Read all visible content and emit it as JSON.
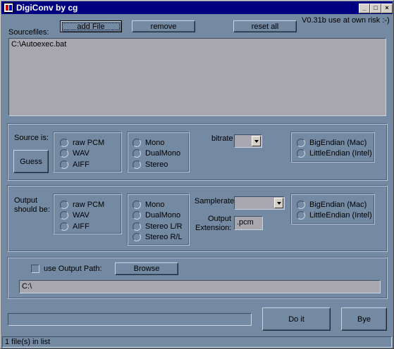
{
  "window": {
    "title": "DigiConv by cg",
    "minimize_glyph": "_",
    "maximize_glyph": "□",
    "close_glyph": "×"
  },
  "toolbar": {
    "add_file_label": "add File",
    "remove_label": "remove",
    "reset_all_label": "reset all",
    "version_text": "V0.31b  use at own risk :-)"
  },
  "sourcefiles": {
    "label": "Sourcefiles:",
    "items": [
      "C:\\Autoexec.bat"
    ]
  },
  "source": {
    "label": "Source is:",
    "guess_label": "Guess",
    "format_options": [
      "raw PCM",
      "WAV",
      "AIFF"
    ],
    "channel_options": [
      "Mono",
      "DualMono",
      "Stereo"
    ],
    "bitrate_label": "bitrate",
    "bitrate_value": "",
    "endian_options": [
      "BigEndian (Mac)",
      "LittleEndian (Intel)"
    ]
  },
  "output": {
    "label_line1": "Output",
    "label_line2": "should be:",
    "format_options": [
      "raw PCM",
      "WAV",
      "AIFF"
    ],
    "channel_options": [
      "Mono",
      "DualMono",
      "Stereo L/R",
      "Stereo R/L"
    ],
    "samplerate_label": "Samplerate:",
    "samplerate_value": "",
    "extension_label_line1": "Output",
    "extension_label_line2": "Extension:",
    "extension_value": ".pcm",
    "endian_options": [
      "BigEndian (Mac)",
      "LittleEndian (Intel)"
    ]
  },
  "output_path": {
    "checkbox_label": "use Output Path:",
    "checked": false,
    "browse_label": "Browse",
    "path_value": "C:\\"
  },
  "actions": {
    "doit_label": "Do it",
    "bye_label": "Bye",
    "progress": 0
  },
  "status": {
    "text": "1 file(s) in list"
  }
}
